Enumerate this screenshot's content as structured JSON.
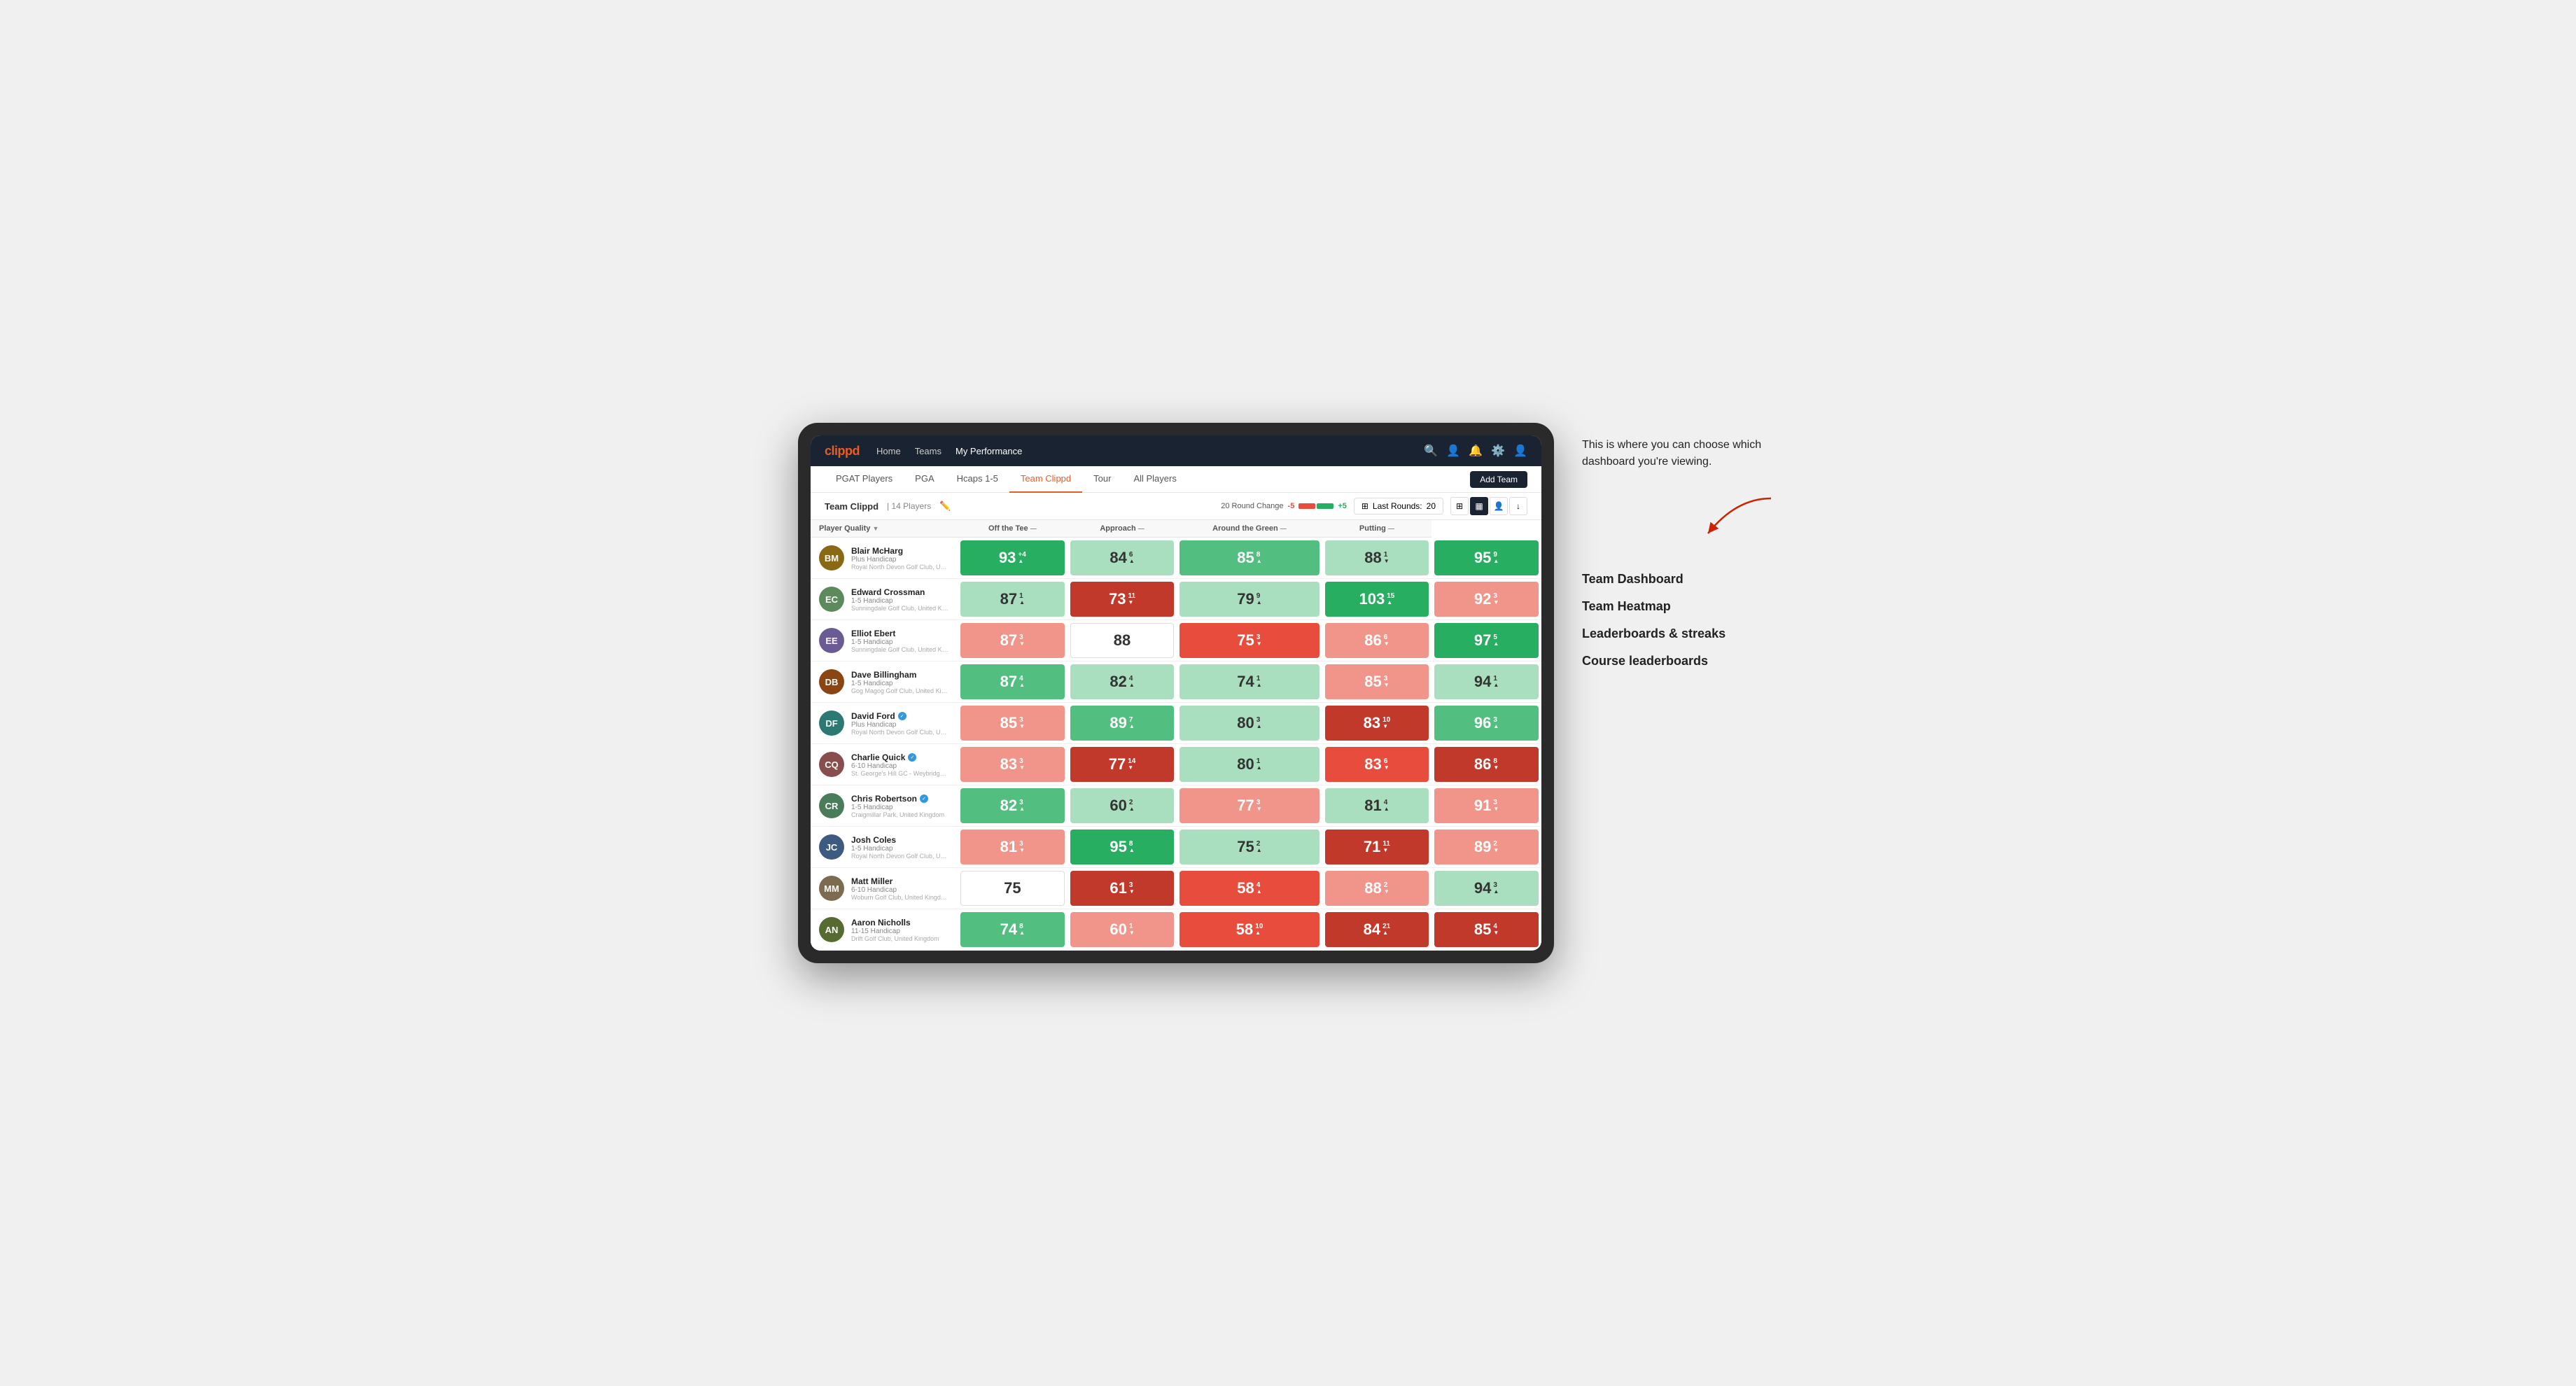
{
  "annotation": {
    "text": "This is where you can choose which dashboard you're viewing.",
    "arrow_label": "→",
    "menu_options": [
      "Team Dashboard",
      "Team Heatmap",
      "Leaderboards & streaks",
      "Course leaderboards"
    ]
  },
  "nav": {
    "logo": "clippd",
    "links": [
      "Home",
      "Teams",
      "My Performance"
    ],
    "active_link": "My Performance"
  },
  "tabs": {
    "items": [
      "PGAT Players",
      "PGA",
      "Hcaps 1-5",
      "Team Clippd",
      "Tour",
      "All Players"
    ],
    "active": "Team Clippd",
    "add_button": "Add Team"
  },
  "sub_header": {
    "team_name": "Team Clippd",
    "separator": "|",
    "player_count": "14 Players",
    "round_change_label": "20 Round Change",
    "change_minus": "-5",
    "change_plus": "+5",
    "last_rounds_label": "Last Rounds:",
    "last_rounds_count": "20"
  },
  "table": {
    "columns": [
      {
        "id": "player",
        "label": "Player Quality",
        "sortable": true
      },
      {
        "id": "off_tee",
        "label": "Off the Tee",
        "sortable": true
      },
      {
        "id": "approach",
        "label": "Approach",
        "sortable": true
      },
      {
        "id": "around_green",
        "label": "Around the Green",
        "sortable": true
      },
      {
        "id": "putting",
        "label": "Putting",
        "sortable": true
      }
    ],
    "rows": [
      {
        "name": "Blair McHarg",
        "verified": false,
        "handicap": "Plus Handicap",
        "club": "Royal North Devon Golf Club, United Kingdom",
        "scores": [
          {
            "value": 93,
            "change": "+4",
            "dir": "up",
            "color": "green-dark"
          },
          {
            "value": 84,
            "change": "6",
            "dir": "up",
            "color": "green-light"
          },
          {
            "value": 85,
            "change": "8",
            "dir": "up",
            "color": "green-mid"
          },
          {
            "value": 88,
            "change": "1",
            "dir": "down",
            "color": "green-light"
          },
          {
            "value": 95,
            "change": "9",
            "dir": "up",
            "color": "green-dark"
          }
        ]
      },
      {
        "name": "Edward Crossman",
        "verified": false,
        "handicap": "1-5 Handicap",
        "club": "Sunningdale Golf Club, United Kingdom",
        "scores": [
          {
            "value": 87,
            "change": "1",
            "dir": "up",
            "color": "green-light"
          },
          {
            "value": 73,
            "change": "11",
            "dir": "down",
            "color": "red-dark"
          },
          {
            "value": 79,
            "change": "9",
            "dir": "up",
            "color": "green-light"
          },
          {
            "value": 103,
            "change": "15",
            "dir": "up",
            "color": "green-dark"
          },
          {
            "value": 92,
            "change": "3",
            "dir": "down",
            "color": "red-light"
          }
        ]
      },
      {
        "name": "Elliot Ebert",
        "verified": false,
        "handicap": "1-5 Handicap",
        "club": "Sunningdale Golf Club, United Kingdom",
        "scores": [
          {
            "value": 87,
            "change": "3",
            "dir": "down",
            "color": "red-light"
          },
          {
            "value": 88,
            "change": "",
            "dir": "",
            "color": "white-bg"
          },
          {
            "value": 75,
            "change": "3",
            "dir": "down",
            "color": "red-mid"
          },
          {
            "value": 86,
            "change": "6",
            "dir": "down",
            "color": "red-light"
          },
          {
            "value": 97,
            "change": "5",
            "dir": "up",
            "color": "green-dark"
          }
        ]
      },
      {
        "name": "Dave Billingham",
        "verified": false,
        "handicap": "1-5 Handicap",
        "club": "Gog Magog Golf Club, United Kingdom",
        "scores": [
          {
            "value": 87,
            "change": "4",
            "dir": "up",
            "color": "green-mid"
          },
          {
            "value": 82,
            "change": "4",
            "dir": "up",
            "color": "green-light"
          },
          {
            "value": 74,
            "change": "1",
            "dir": "up",
            "color": "green-light"
          },
          {
            "value": 85,
            "change": "3",
            "dir": "down",
            "color": "red-light"
          },
          {
            "value": 94,
            "change": "1",
            "dir": "up",
            "color": "green-light"
          }
        ]
      },
      {
        "name": "David Ford",
        "verified": true,
        "handicap": "Plus Handicap",
        "club": "Royal North Devon Golf Club, United Kingdom",
        "scores": [
          {
            "value": 85,
            "change": "3",
            "dir": "down",
            "color": "red-light"
          },
          {
            "value": 89,
            "change": "7",
            "dir": "up",
            "color": "green-mid"
          },
          {
            "value": 80,
            "change": "3",
            "dir": "up",
            "color": "green-light"
          },
          {
            "value": 83,
            "change": "10",
            "dir": "down",
            "color": "red-dark"
          },
          {
            "value": 96,
            "change": "3",
            "dir": "up",
            "color": "green-mid"
          }
        ]
      },
      {
        "name": "Charlie Quick",
        "verified": true,
        "handicap": "6-10 Handicap",
        "club": "St. George's Hill GC - Weybridge - Surrey, Uni...",
        "scores": [
          {
            "value": 83,
            "change": "3",
            "dir": "down",
            "color": "red-light"
          },
          {
            "value": 77,
            "change": "14",
            "dir": "down",
            "color": "red-dark"
          },
          {
            "value": 80,
            "change": "1",
            "dir": "up",
            "color": "green-light"
          },
          {
            "value": 83,
            "change": "6",
            "dir": "down",
            "color": "red-mid"
          },
          {
            "value": 86,
            "change": "8",
            "dir": "down",
            "color": "red-dark"
          }
        ]
      },
      {
        "name": "Chris Robertson",
        "verified": true,
        "handicap": "1-5 Handicap",
        "club": "Craigmillar Park, United Kingdom",
        "scores": [
          {
            "value": 82,
            "change": "3",
            "dir": "up",
            "color": "green-mid"
          },
          {
            "value": 60,
            "change": "2",
            "dir": "up",
            "color": "green-light"
          },
          {
            "value": 77,
            "change": "3",
            "dir": "down",
            "color": "red-light"
          },
          {
            "value": 81,
            "change": "4",
            "dir": "up",
            "color": "green-light"
          },
          {
            "value": 91,
            "change": "3",
            "dir": "down",
            "color": "red-light"
          }
        ]
      },
      {
        "name": "Josh Coles",
        "verified": false,
        "handicap": "1-5 Handicap",
        "club": "Royal North Devon Golf Club, United Kingdom",
        "scores": [
          {
            "value": 81,
            "change": "3",
            "dir": "down",
            "color": "red-light"
          },
          {
            "value": 95,
            "change": "8",
            "dir": "up",
            "color": "green-dark"
          },
          {
            "value": 75,
            "change": "2",
            "dir": "up",
            "color": "green-light"
          },
          {
            "value": 71,
            "change": "11",
            "dir": "down",
            "color": "red-dark"
          },
          {
            "value": 89,
            "change": "2",
            "dir": "down",
            "color": "red-light"
          }
        ]
      },
      {
        "name": "Matt Miller",
        "verified": false,
        "handicap": "6-10 Handicap",
        "club": "Woburn Golf Club, United Kingdom",
        "scores": [
          {
            "value": 75,
            "change": "",
            "dir": "",
            "color": "white-bg"
          },
          {
            "value": 61,
            "change": "3",
            "dir": "down",
            "color": "red-dark"
          },
          {
            "value": 58,
            "change": "4",
            "dir": "up",
            "color": "red-mid"
          },
          {
            "value": 88,
            "change": "2",
            "dir": "down",
            "color": "red-light"
          },
          {
            "value": 94,
            "change": "3",
            "dir": "up",
            "color": "green-light"
          }
        ]
      },
      {
        "name": "Aaron Nicholls",
        "verified": false,
        "handicap": "11-15 Handicap",
        "club": "Drift Golf Club, United Kingdom",
        "scores": [
          {
            "value": 74,
            "change": "8",
            "dir": "up",
            "color": "green-mid"
          },
          {
            "value": 60,
            "change": "1",
            "dir": "down",
            "color": "red-light"
          },
          {
            "value": 58,
            "change": "10",
            "dir": "up",
            "color": "red-mid"
          },
          {
            "value": 84,
            "change": "21",
            "dir": "up",
            "color": "red-dark"
          },
          {
            "value": 85,
            "change": "4",
            "dir": "down",
            "color": "red-dark"
          }
        ]
      }
    ]
  }
}
